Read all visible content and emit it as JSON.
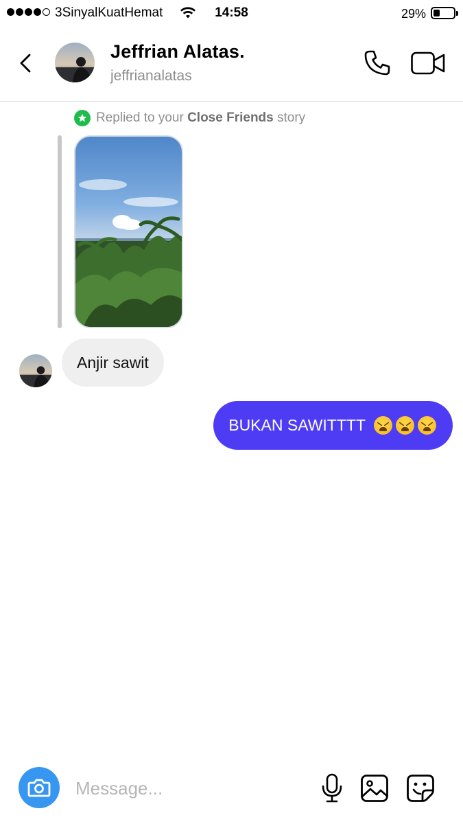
{
  "status_bar": {
    "carrier": "3SinyalKuatHemat",
    "time": "14:58",
    "battery_percent": "29%",
    "battery_level": 0.29,
    "icons": [
      "signal-dots-icon",
      "wifi-icon",
      "battery-icon"
    ]
  },
  "header": {
    "name": "Jeffrian Alatas.",
    "handle": "jeffrianalatas",
    "icons": [
      "back-chevron-icon",
      "avatar",
      "phone-icon",
      "video-camera-icon"
    ]
  },
  "story_reply": {
    "prefix": "Replied to your ",
    "highlight": "Close Friends",
    "suffix": " story",
    "badge_icon": "green-star-icon",
    "badge_color": "#1ebd4b"
  },
  "messages": [
    {
      "from": "contact",
      "text": "Anjir sawit"
    },
    {
      "from": "me",
      "text": "BUKAN SAWITTTT",
      "emoji_count": 3,
      "emoji": "tired-face-emoji"
    }
  ],
  "composer": {
    "placeholder": "Message...",
    "icons": [
      "camera-icon",
      "microphone-icon",
      "gallery-icon",
      "sticker-icon"
    ]
  },
  "colors": {
    "outgoing_bubble": "#4e3cf5",
    "incoming_bubble": "#efefef",
    "camera_button": "#3797f0",
    "secondary_text": "#8e8e8e"
  }
}
